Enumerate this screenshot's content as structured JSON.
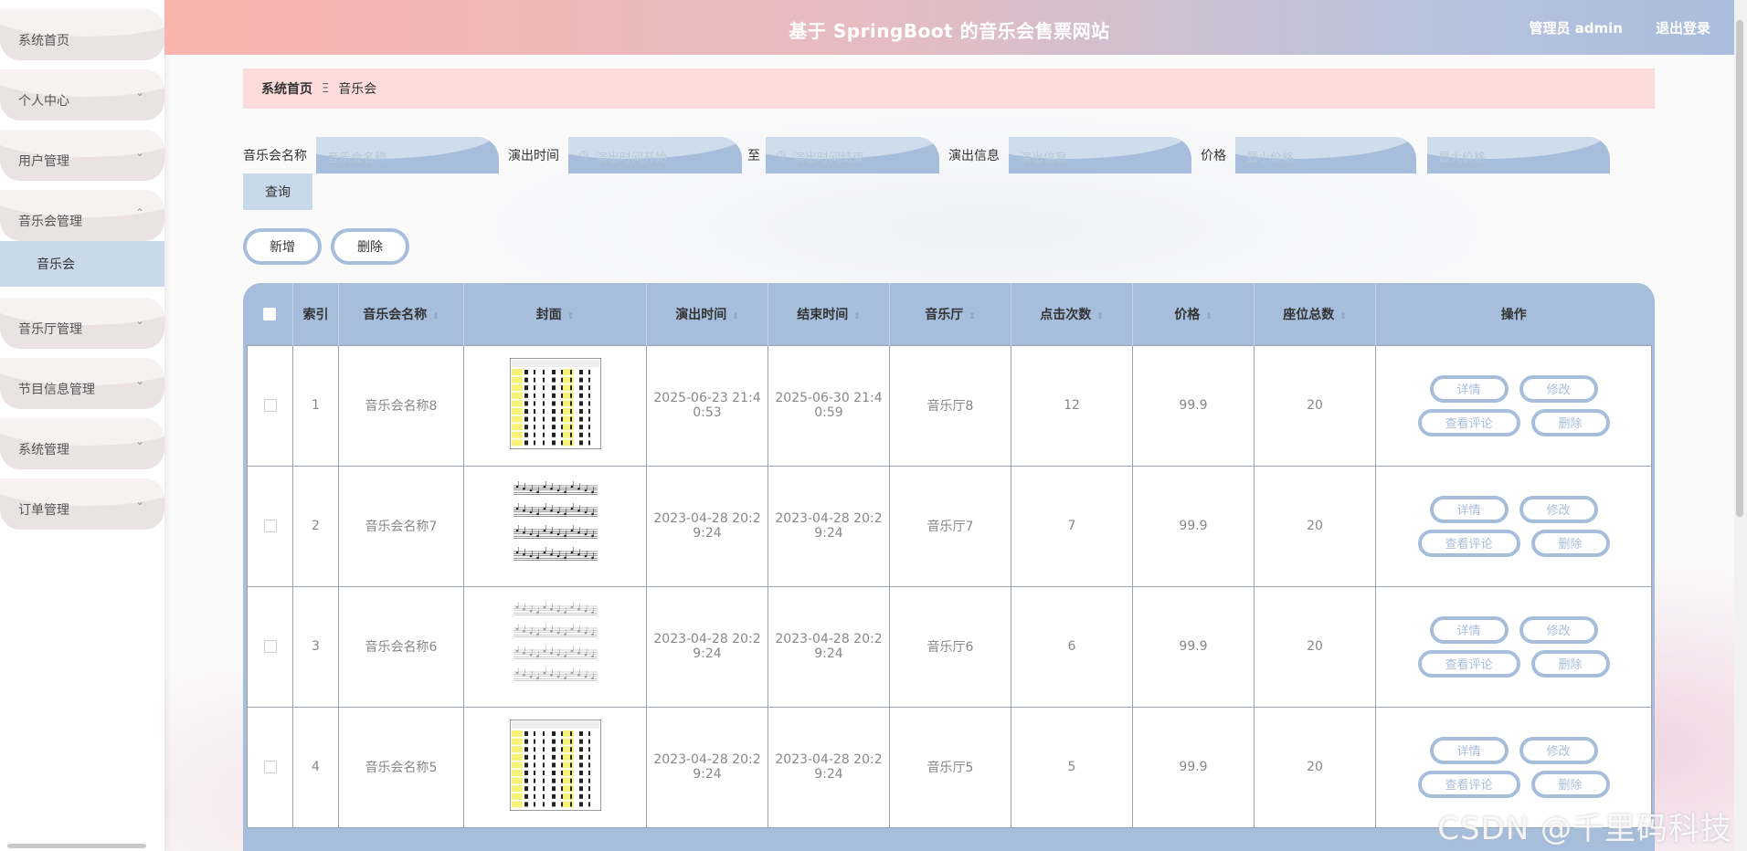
{
  "header": {
    "title": "基于 SpringBoot 的音乐会售票网站",
    "user": "管理员 admin",
    "logout": "退出登录"
  },
  "sidebar": {
    "items": [
      {
        "label": "系统首页",
        "chevron": ""
      },
      {
        "label": "个人中心",
        "chevron": "⌄"
      },
      {
        "label": "用户管理",
        "chevron": "⌄"
      },
      {
        "label": "音乐会管理",
        "chevron": "⌃"
      },
      {
        "label": "音乐厅管理",
        "chevron": "⌄"
      },
      {
        "label": "节目信息管理",
        "chevron": "⌄"
      },
      {
        "label": "系统管理",
        "chevron": "⌄"
      },
      {
        "label": "订单管理",
        "chevron": "⌄"
      }
    ],
    "active_sub": "音乐会"
  },
  "breadcrumb": {
    "home": "系统首页",
    "separator": "Ξ",
    "current": "音乐会"
  },
  "search": {
    "name_label": "音乐会名称",
    "name_placeholder": "音乐会名称",
    "time_label": "演出时间",
    "time_start_placeholder": "演出时间开始",
    "time_to": "至",
    "time_end_placeholder": "演出时间结束",
    "info_label": "演出信息",
    "info_placeholder": "演出信息",
    "price_label": "价格",
    "price_min_placeholder": "最小价格",
    "price_max_placeholder": "最大价格",
    "query_button": "查询"
  },
  "actions": {
    "add": "新增",
    "delete": "删除"
  },
  "table": {
    "columns": [
      "索引",
      "音乐会名称",
      "封面",
      "演出时间",
      "结束时间",
      "音乐厅",
      "点击次数",
      "价格",
      "座位总数",
      "操作"
    ],
    "row_actions": {
      "detail": "详情",
      "edit": "修改",
      "comments": "查看评论",
      "delete": "删除"
    },
    "rows": [
      {
        "index": "1",
        "name": "音乐会名称8",
        "start_a": "2025-06-23 21:4",
        "start_b": "0:53",
        "end_a": "2025-06-30 21:4",
        "end_b": "0:59",
        "hall": "音乐厅8",
        "clicks": "12",
        "price": "99.9",
        "seats": "20",
        "cover": "table"
      },
      {
        "index": "2",
        "name": "音乐会名称7",
        "start_a": "2023-04-28 20:2",
        "start_b": "9:24",
        "end_a": "2023-04-28 20:2",
        "end_b": "9:24",
        "hall": "音乐厅7",
        "clicks": "7",
        "price": "99.9",
        "seats": "20",
        "cover": "score"
      },
      {
        "index": "3",
        "name": "音乐会名称6",
        "start_a": "2023-04-28 20:2",
        "start_b": "9:24",
        "end_a": "2023-04-28 20:2",
        "end_b": "9:24",
        "hall": "音乐厅6",
        "clicks": "6",
        "price": "99.9",
        "seats": "20",
        "cover": "score-light"
      },
      {
        "index": "4",
        "name": "音乐会名称5",
        "start_a": "2023-04-28 20:2",
        "start_b": "9:24",
        "end_a": "2023-04-28 20:2",
        "end_b": "9:24",
        "hall": "音乐厅5",
        "clicks": "5",
        "price": "99.9",
        "seats": "20",
        "cover": "table"
      }
    ]
  },
  "watermark": "CSDN @千里码科技",
  "colors": {
    "accent_blue": "#a6bedc",
    "breadcrumb_bg": "#fcdcdb",
    "header_left": "#f9b4ad",
    "header_right": "#a9bddc",
    "sidebar_item": "#ebe3e3",
    "active_sub": "#c9d9ea"
  }
}
